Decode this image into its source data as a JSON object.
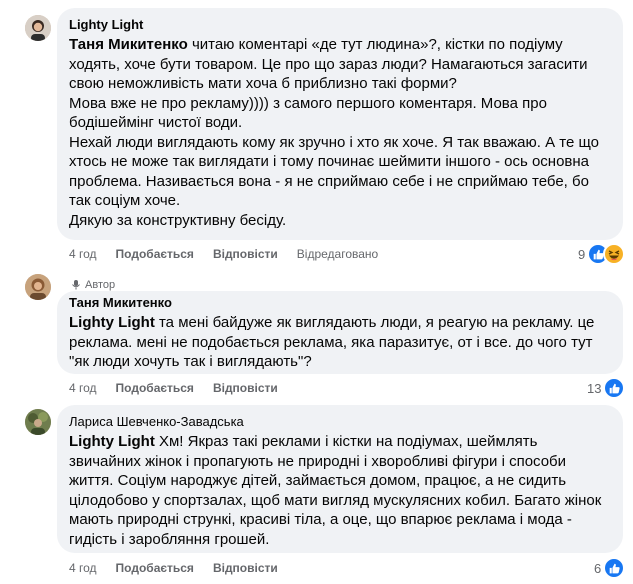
{
  "comments": [
    {
      "author": "Lighty Light",
      "is_author": false,
      "mention": "Таня Микитенко",
      "paragraphs": [
        " читаю коментарі «де тут людина»?, кістки по подіуму ходять, хоче бути товаром. Це про що зараз люди? Намагаються загасити свою неможливість мати хоча б приблизно такі форми?",
        "Мова вже не про рекламу)))) з самого першого коментаря. Мова про бодішеймінг чистої води.",
        "Нехай люди виглядають кому як зручно і хто як хоче. Я так вважаю. А те що хтось не може так виглядати і тому починає шеймити іншого - ось основна проблема. Називається вона - я не сприймаю себе і не сприймаю тебе, бо так соціум хоче.",
        "Дякую за конструктивну бесіду."
      ],
      "time": "4 год",
      "like": "Подобається",
      "reply": "Відповісти",
      "edited": "Відредаговано",
      "reaction_count": "9",
      "reactions": [
        "like-icon",
        "haha-icon"
      ]
    },
    {
      "author": "Таня Микитенко",
      "is_author": true,
      "author_label": "Автор",
      "mention": "Lighty Light",
      "text": " та мені байдуже як виглядають люди, я реагую на рекламу. це реклама. мені не подобається реклама, яка паразитує, от і все. до чого тут \"як люди хочуть так і виглядають\"?",
      "time": "4 год",
      "like": "Подобається",
      "reply": "Відповісти",
      "reaction_count": "13",
      "reactions": [
        "like-icon"
      ]
    },
    {
      "author": "Лариса Шевченко-Завадська",
      "is_author": false,
      "mention": "Lighty Light",
      "text": " Хм! Якраз такі реклами і кістки на подіумах, шеймлять звичайних жінок і пропагують не природні і хворобливі фігури і способи життя. Соціум народжує дітей, займається домом, працює, а не сидить цілодобово у спортзалах, щоб мати вигляд мускулясних кобил. Багато жінок мають природні стрункі, красиві тіла, а оце, що впарює реклама і мода - гидість і заробляння грошей.",
      "time": "4 год",
      "like": "Подобається",
      "reply": "Відповісти",
      "reaction_count": "6",
      "reactions": [
        "like-icon"
      ]
    }
  ],
  "colors": {
    "bubble": "#f0f2f5",
    "meta": "#65676b",
    "like_blue": "#1877f2",
    "haha_yellow": "#f7b125"
  }
}
